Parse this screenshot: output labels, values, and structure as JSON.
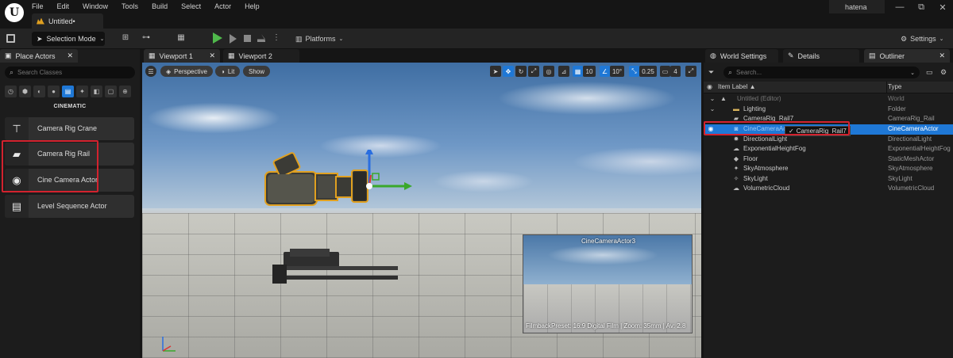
{
  "menu": [
    "File",
    "Edit",
    "Window",
    "Tools",
    "Build",
    "Select",
    "Actor",
    "Help"
  ],
  "document_tab": "Untitled•",
  "user": "hatena",
  "window_controls": {
    "minimize": "—",
    "maximize": "⧉",
    "close": "✕"
  },
  "toolbar": {
    "selection_mode": "Selection Mode",
    "platforms": "Platforms",
    "settings": "Settings"
  },
  "place_actors": {
    "tab": "Place Actors",
    "search_placeholder": "Search Classes",
    "category": "CINEMATIC",
    "items": [
      {
        "label": "Camera Rig Crane",
        "icon": "crane-icon",
        "glyph": "⊤"
      },
      {
        "label": "Camera Rig Rail",
        "icon": "rail-icon",
        "glyph": "▰"
      },
      {
        "label": "Cine Camera Actor",
        "icon": "cine-camera-icon",
        "glyph": "◉"
      },
      {
        "label": "Level Sequence Actor",
        "icon": "clapperboard-icon",
        "glyph": "▤"
      }
    ]
  },
  "viewport_tabs": [
    "Viewport 1",
    "Viewport 2"
  ],
  "viewport": {
    "perspective": "Perspective",
    "lit": "Lit",
    "show": "Show",
    "grid_snap": "10",
    "rotation_snap": "10°",
    "scale_snap": "0.25",
    "camera_speed": "4"
  },
  "pip": {
    "title": "CineCameraActor3",
    "info": "FilmbackPreset: 16:9 Digital Film | Zoom: 35mm | Av: 2.8"
  },
  "right_tabs": [
    "World Settings",
    "Details",
    "Outliner"
  ],
  "outliner": {
    "search_placeholder": "Search...",
    "col_label": "Item Label ▲",
    "col_type": "Type",
    "rows": [
      {
        "label": "Untitled (Editor)",
        "type": "World"
      },
      {
        "label": "Lighting",
        "type": "Folder"
      },
      {
        "label": "CameraRig_Rail7",
        "type": "CameraRig_Rail"
      },
      {
        "label": "CineCameraActor3",
        "type": "CineCameraActor"
      },
      {
        "label": "DirectionalLight",
        "type": "DirectionalLight"
      },
      {
        "label": "ExponentialHeightFog",
        "type": "ExponentialHeightFog"
      },
      {
        "label": "Floor",
        "type": "StaticMeshActor"
      },
      {
        "label": "SkyAtmosphere",
        "type": "SkyAtmosphere"
      },
      {
        "label": "SkyLight",
        "type": "SkyLight"
      },
      {
        "label": "VolumetricCloud",
        "type": "VolumetricCloud"
      }
    ],
    "tooltip": "CameraRig_Rail7"
  },
  "colors": {
    "accent": "#1f78d6",
    "highlight": "#d3222e",
    "play": "#4fb84b"
  }
}
